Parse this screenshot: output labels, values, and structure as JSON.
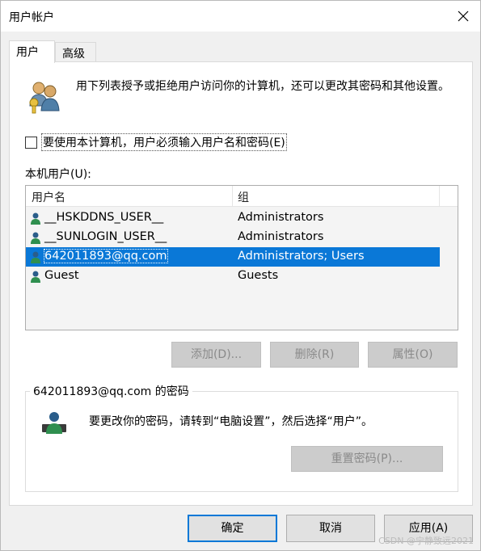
{
  "window": {
    "title": "用户帐户"
  },
  "tabs": [
    {
      "label": "用户"
    },
    {
      "label": "高级"
    }
  ],
  "intro": {
    "text": "用下列表授予或拒绝用户访问你的计算机，还可以更改其密码和其他设置。"
  },
  "require_login": {
    "label": "要使用本计算机，用户必须输入用户名和密码(E)",
    "checked": false
  },
  "local_users": {
    "label": "本机用户(U):",
    "columns": [
      "用户名",
      "组"
    ],
    "rows": [
      {
        "name": "__HSKDDNS_USER__",
        "group": "Administrators",
        "selected": false
      },
      {
        "name": "__SUNLOGIN_USER__",
        "group": "Administrators",
        "selected": false
      },
      {
        "name": "642011893@qq.com",
        "group": "Administrators; Users",
        "selected": true
      },
      {
        "name": "Guest",
        "group": "Guests",
        "selected": false
      }
    ]
  },
  "actions": {
    "add": "添加(D)...",
    "remove": "删除(R)",
    "properties": "属性(O)"
  },
  "password": {
    "title": "642011893@qq.com 的密码",
    "text": "要更改你的密码，请转到“电脑设置”，然后选择“用户”。",
    "reset": "重置密码(P)..."
  },
  "footer": {
    "ok": "确定",
    "cancel": "取消",
    "apply": "应用(A)"
  },
  "watermark": "CSDN @宁静致远2021",
  "colors": {
    "selection": "#0a78d7",
    "accent": "#0078d7"
  }
}
